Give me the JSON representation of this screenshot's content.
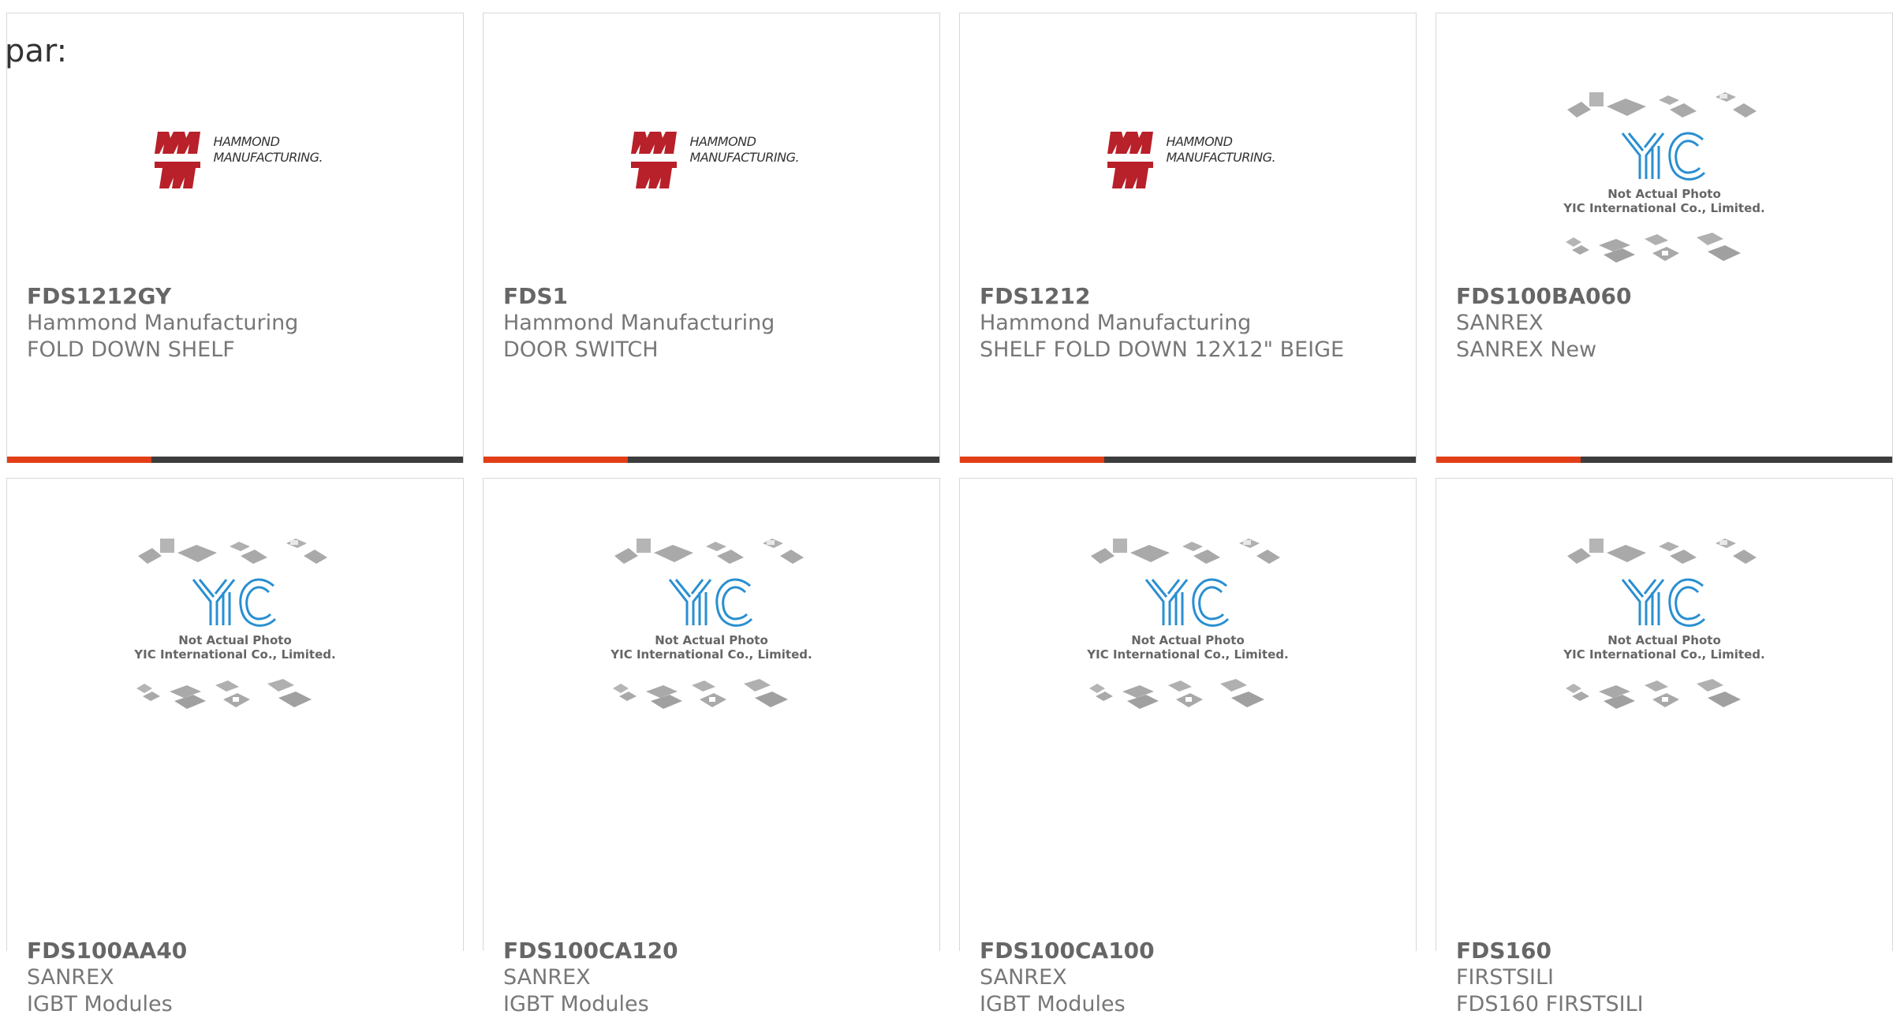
{
  "page_label": "par:",
  "brand_colors": {
    "accent": "#e23e17",
    "bar": "#3d3d3d",
    "hammond_red": "#b8202a",
    "yic_blue": "#2a8fd0"
  },
  "placeholder_text": {
    "line1": "Not Actual Photo",
    "line2": "YIC International Co., Limited."
  },
  "hammond_logo_text": {
    "line1": "HAMMOND",
    "line2": "MANUFACTURING."
  },
  "products": [
    {
      "part_number": "FDS1212GY",
      "manufacturer": "Hammond Manufacturing",
      "description": "FOLD DOWN SHELF",
      "image": "hammond-logo"
    },
    {
      "part_number": "FDS1",
      "manufacturer": "Hammond Manufacturing",
      "description": "DOOR SWITCH",
      "image": "hammond-logo"
    },
    {
      "part_number": "FDS1212",
      "manufacturer": "Hammond Manufacturing",
      "description": "SHELF FOLD DOWN 12X12\" BEIGE",
      "image": "hammond-logo"
    },
    {
      "part_number": "FDS100BA060",
      "manufacturer": "SANREX",
      "description": "SANREX New",
      "image": "yic-placeholder"
    },
    {
      "part_number": "FDS100AA40",
      "manufacturer": "SANREX",
      "description": "IGBT Modules",
      "image": "yic-placeholder"
    },
    {
      "part_number": "FDS100CA120",
      "manufacturer": "SANREX",
      "description": "IGBT Modules",
      "image": "yic-placeholder"
    },
    {
      "part_number": "FDS100CA100",
      "manufacturer": "SANREX",
      "description": "IGBT Modules",
      "image": "yic-placeholder"
    },
    {
      "part_number": "FDS160",
      "manufacturer": "FIRSTSILI",
      "description": "FDS160 FIRSTSILI",
      "image": "yic-placeholder"
    }
  ]
}
